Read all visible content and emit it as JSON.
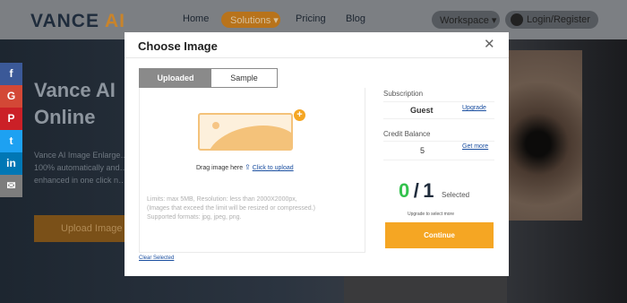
{
  "header": {
    "logo": {
      "brand": "VANCE",
      "suffix": "AI"
    },
    "nav": {
      "home": "Home",
      "solutions": "Solutions ▾",
      "pricing": "Pricing",
      "blog": "Blog"
    },
    "workspace": "Workspace ▾",
    "login": "Login/Register"
  },
  "hero": {
    "title_line1": "Vance AI",
    "title_line2": "Online",
    "text": "Vance AI Image Enlarge… 100% automatically and… enhanced in one click n…",
    "upload_button": "Upload Image"
  },
  "social": [
    "f",
    "G",
    "P",
    "t",
    "in",
    "✉"
  ],
  "modal": {
    "title": "Choose Image",
    "tabs": {
      "uploaded": "Uploaded",
      "sample": "Sample"
    },
    "dropzone": {
      "drag_text": "Drag image here",
      "click_upload": "Click to upload",
      "limits_line1": "Limits: max 5MB,  Resolution: less than 2000X2000px,",
      "limits_line2": "(Images that exceed the limit will be resized or compressed.)",
      "limits_line3": "Supported formats: jpg, jpeg, png."
    },
    "clear_selected": "Clear Selected",
    "subscription": {
      "label": "Subscription",
      "value": "Guest",
      "link": "Upgrade"
    },
    "credit": {
      "label": "Credit Balance",
      "value": "5",
      "link": "Get more"
    },
    "selection": {
      "selected": "0",
      "slash": "/",
      "total": "1",
      "label": "Selected"
    },
    "upgrade_note": "Upgrade to select more",
    "continue": "Continue"
  },
  "colors": {
    "accent": "#f5a623",
    "selected_green": "#33c24d",
    "link_blue": "#1b4fa0"
  }
}
